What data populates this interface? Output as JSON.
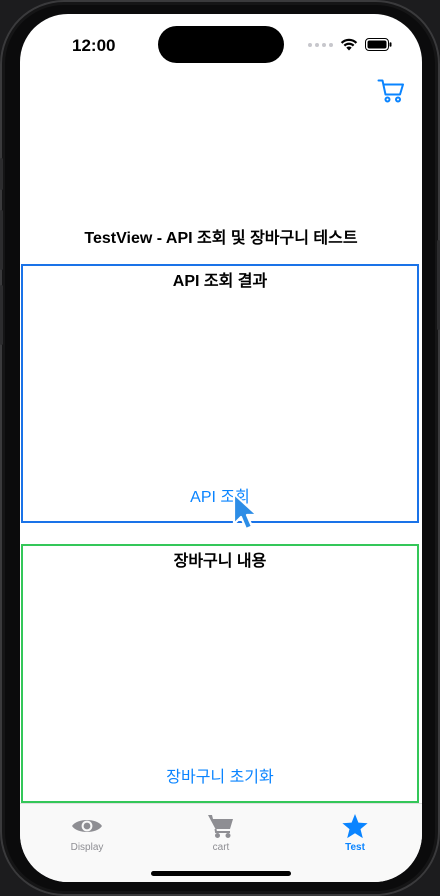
{
  "status_bar": {
    "time": "12:00"
  },
  "nav": {
    "cart_icon": "cart-icon"
  },
  "page": {
    "title": "TestView - API 조회 및 장바구니 테스트"
  },
  "api_section": {
    "title": "API 조회 결과",
    "action_label": "API 조회",
    "border_color": "#1a73e8"
  },
  "cart_section": {
    "title": "장바구니 내용",
    "action_label": "장바구니 초기화",
    "border_color": "#34c759"
  },
  "tabbar": {
    "tabs": [
      {
        "label": "Display",
        "icon": "eye-icon",
        "active": false
      },
      {
        "label": "cart",
        "icon": "cart-icon",
        "active": false
      },
      {
        "label": "Test",
        "icon": "star-icon",
        "active": true
      }
    ]
  },
  "colors": {
    "accent": "#0a84ff",
    "inactive": "#8e8e93"
  }
}
